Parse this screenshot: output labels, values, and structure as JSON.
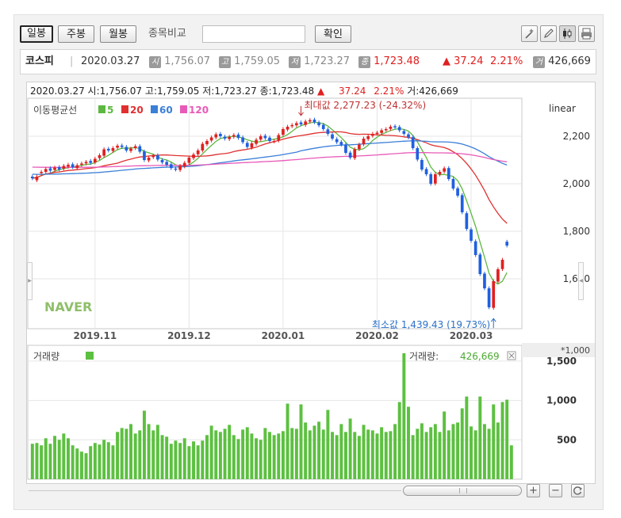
{
  "toolbar": {
    "period_buttons": [
      {
        "label": "일봉",
        "active": true
      },
      {
        "label": "주봉",
        "active": false
      },
      {
        "label": "월봉",
        "active": false
      }
    ],
    "compare_label": "종목비교",
    "compare_value": "",
    "confirm_label": "확인",
    "tool_icons": [
      "magic-wand-icon",
      "pencil-icon",
      "candle-type-icon",
      "print-icon"
    ]
  },
  "info": {
    "name": "코스피",
    "date": "2020.03.27",
    "open_label": "시",
    "open": "1,756.07",
    "high_label": "고",
    "high": "1,759.05",
    "low_label": "저",
    "low": "1,723.27",
    "close_label": "종",
    "close": "1,723.48",
    "change": "▲ 37.24",
    "change_pct": "2.21%",
    "volume_label": "거",
    "volume": "426,669",
    "colors": {
      "up": "#e02020",
      "muted": "#888888"
    }
  },
  "chart_ohlc_line": {
    "date": "2020.03.27",
    "open": "시:1,756.07",
    "high": "고:1,759.05",
    "low": "저:1,723.27",
    "close": "종:1,723.48",
    "arrow": "▲",
    "change": "37.24",
    "pct": "2.21%",
    "vol": "거:426,669"
  },
  "chart_data": [
    {
      "type": "line",
      "panel": "price",
      "scale_label": "linear",
      "ylim": [
        1390,
        2360
      ],
      "y_ticks": [
        "2,200",
        "2,000",
        "1,800",
        "1,600"
      ],
      "y_tick_values": [
        2200,
        2000,
        1800,
        1600
      ],
      "x_ticks": [
        "2019.11",
        "2019.12",
        "2020.01",
        "2020.02",
        "2020.03"
      ],
      "x_tick_index": [
        14,
        35,
        56,
        77,
        98
      ],
      "legend_title": "이동평균선",
      "ma_series": [
        {
          "name": "5",
          "color": "#5cb840"
        },
        {
          "name": "20",
          "color": "#e03030"
        },
        {
          "name": "60",
          "color": "#3a7fd8"
        },
        {
          "name": "120",
          "color": "#e85ab8"
        }
      ],
      "closes": [
        2023,
        2030,
        2050,
        2062,
        2055,
        2068,
        2060,
        2075,
        2080,
        2070,
        2078,
        2085,
        2092,
        2088,
        2105,
        2120,
        2145,
        2140,
        2150,
        2160,
        2155,
        2140,
        2148,
        2158,
        2135,
        2100,
        2110,
        2118,
        2102,
        2090,
        2080,
        2066,
        2060,
        2075,
        2088,
        2110,
        2123,
        2140,
        2168,
        2180,
        2195,
        2208,
        2200,
        2190,
        2197,
        2205,
        2193,
        2175,
        2155,
        2170,
        2185,
        2200,
        2192,
        2180,
        2180,
        2205,
        2230,
        2240,
        2247,
        2255,
        2250,
        2262,
        2268,
        2259,
        2246,
        2230,
        2210,
        2190,
        2175,
        2165,
        2130,
        2110,
        2145,
        2165,
        2190,
        2200,
        2210,
        2215,
        2225,
        2230,
        2240,
        2238,
        2225,
        2210,
        2195,
        2150,
        2102,
        2060,
        2040,
        2000,
        2040,
        2050,
        2065,
        2020,
        1980,
        1950,
        1880,
        1810,
        1760,
        1700,
        1620,
        1560,
        1480,
        1590,
        1640,
        1680,
        1740
      ],
      "opens": [
        2030,
        2015,
        2045,
        2050,
        2065,
        2058,
        2070,
        2064,
        2072,
        2082,
        2066,
        2080,
        2086,
        2096,
        2090,
        2108,
        2118,
        2147,
        2138,
        2152,
        2161,
        2155,
        2138,
        2150,
        2158,
        2136,
        2098,
        2112,
        2120,
        2100,
        2092,
        2082,
        2064,
        2058,
        2073,
        2088,
        2108,
        2124,
        2140,
        2166,
        2182,
        2195,
        2210,
        2198,
        2188,
        2198,
        2207,
        2195,
        2172,
        2152,
        2168,
        2186,
        2202,
        2194,
        2178,
        2182,
        2206,
        2228,
        2242,
        2246,
        2258,
        2248,
        2262,
        2270,
        2258,
        2248,
        2229,
        2208,
        2188,
        2176,
        2165,
        2131,
        2108,
        2146,
        2166,
        2188,
        2202,
        2211,
        2214,
        2226,
        2231,
        2242,
        2239,
        2222,
        2208,
        2196,
        2150,
        2100,
        2062,
        2040,
        2001,
        2039,
        2051,
        2066,
        2020,
        1981,
        1952,
        1876,
        1808,
        1758,
        1702,
        1622,
        1560,
        1478,
        1588,
        1641,
        1756
      ],
      "minimum": {
        "label": "최소값 1,439.43 (19.73%)",
        "value": 1439.43,
        "index": 103
      },
      "maximum": {
        "label": "최대값 2,277.23 (-24.32%)",
        "value": 2277.23,
        "index": 60
      },
      "watermark": "NAVER"
    },
    {
      "type": "bar",
      "panel": "volume",
      "title": "거래량",
      "unit": "*1,000",
      "ylim": [
        0,
        1700
      ],
      "y_ticks": [
        "1,500",
        "1,000",
        "500"
      ],
      "y_tick_values": [
        1500,
        1000,
        500
      ],
      "current_label": "거래량:",
      "current_value": "426,669",
      "color": "#5cc040",
      "values": [
        450,
        460,
        430,
        520,
        450,
        550,
        500,
        580,
        520,
        430,
        390,
        350,
        330,
        420,
        460,
        440,
        500,
        470,
        430,
        600,
        650,
        640,
        700,
        580,
        620,
        870,
        700,
        620,
        690,
        560,
        540,
        450,
        490,
        460,
        520,
        420,
        480,
        430,
        490,
        560,
        680,
        620,
        600,
        640,
        690,
        560,
        510,
        630,
        660,
        580,
        520,
        500,
        650,
        600,
        560,
        580,
        610,
        960,
        650,
        640,
        950,
        720,
        620,
        680,
        730,
        630,
        880,
        600,
        560,
        700,
        600,
        770,
        600,
        550,
        690,
        630,
        620,
        580,
        660,
        600,
        610,
        700,
        980,
        1600,
        920,
        560,
        640,
        710,
        600,
        660,
        700,
        600,
        860,
        620,
        700,
        720,
        900,
        1050,
        670,
        620,
        1050,
        700,
        640,
        950,
        720,
        980,
        1010,
        430
      ]
    }
  ],
  "footer": {
    "zoom_in": "+",
    "zoom_out": "−",
    "reset_icon": "refresh-icon"
  }
}
